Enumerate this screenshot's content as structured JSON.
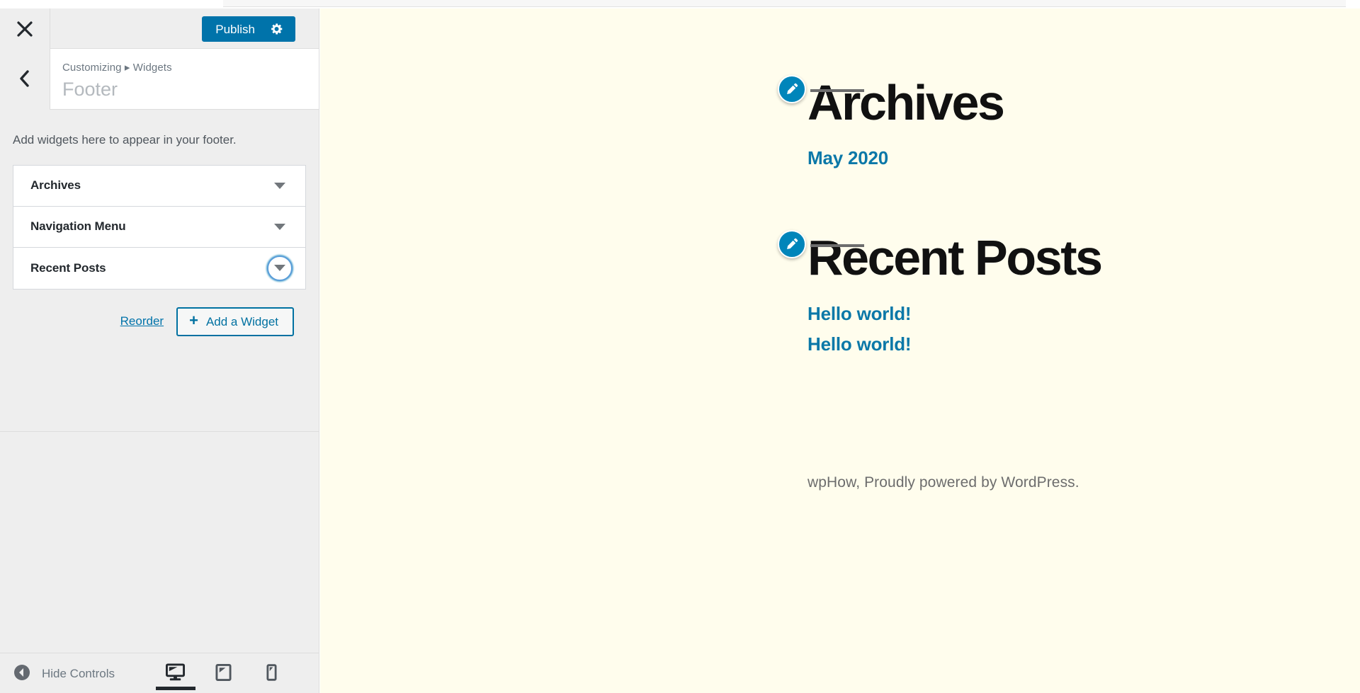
{
  "app": {
    "accent_blue": "#0073aa",
    "preview_bg": "#fffded",
    "sidebar_bg": "#eeeeee"
  },
  "sidebar": {
    "header": {
      "close_icon": "close-icon",
      "publish_label": "Publish",
      "settings_icon": "gear-icon"
    },
    "panel": {
      "back_icon": "chevron-left-icon",
      "breadcrumb": "Customizing ▸ Widgets",
      "title": "Footer"
    },
    "widgets": {
      "description": "Add widgets here to appear in your footer.",
      "items": [
        {
          "title": "Archives",
          "toggle_icon": "chevron-down-icon",
          "focused": false
        },
        {
          "title": "Navigation Menu",
          "toggle_icon": "chevron-down-icon",
          "focused": false
        },
        {
          "title": "Recent Posts",
          "toggle_icon": "chevron-down-icon",
          "focused": true
        }
      ],
      "reorder_label": "Reorder",
      "add_widget_label": "Add a Widget",
      "add_widget_icon": "plus-icon"
    },
    "footer": {
      "hide_controls_label": "Hide Controls",
      "collapse_icon": "collapse-left-icon",
      "devices": [
        {
          "name": "desktop",
          "icon": "desktop-icon",
          "active": true
        },
        {
          "name": "tablet",
          "icon": "tablet-icon",
          "active": false
        },
        {
          "name": "mobile",
          "icon": "mobile-icon",
          "active": false
        }
      ]
    }
  },
  "preview": {
    "widgets": [
      {
        "edit_icon": "pencil-edit-icon",
        "heading": "Archives",
        "links": [
          "May 2020"
        ]
      },
      {
        "edit_icon": "pencil-edit-icon",
        "heading": "Recent Posts",
        "links": [
          "Hello world!",
          "Hello world!"
        ]
      }
    ],
    "credit": "wpHow, Proudly powered by WordPress."
  }
}
